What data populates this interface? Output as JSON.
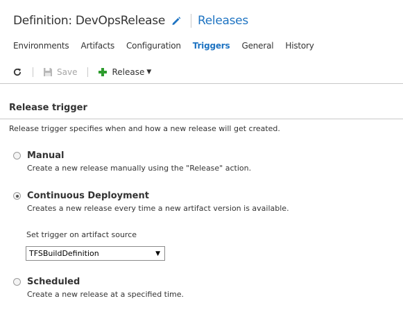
{
  "header": {
    "title": "Definition: DevOpsRelease",
    "link": "Releases"
  },
  "tabs": [
    {
      "label": "Environments"
    },
    {
      "label": "Artifacts"
    },
    {
      "label": "Configuration"
    },
    {
      "label": "Triggers",
      "active": true
    },
    {
      "label": "General"
    },
    {
      "label": "History"
    }
  ],
  "toolbar": {
    "save_label": "Save",
    "release_label": "Release",
    "icons": [
      "refresh-icon",
      "save-disk-icon",
      "plus-icon",
      "caret-down-icon"
    ],
    "colors": {
      "plus": "#2e9c2e",
      "disabled": "#a6a6a6"
    }
  },
  "trigger": {
    "section_title": "Release trigger",
    "description": "Release trigger specifies when and how a new release will get created.",
    "options": {
      "manual": {
        "title": "Manual",
        "desc": "Create a new release manually using the \"Release\" action.",
        "checked": false
      },
      "continuous": {
        "title": "Continuous Deployment",
        "desc": "Creates a new release every time a new artifact version is available.",
        "checked": true
      },
      "scheduled": {
        "title": "Scheduled",
        "desc": "Create a new release at a specified time.",
        "checked": false
      }
    },
    "artifact_label": "Set trigger on artifact source",
    "artifact_value": "TFSBuildDefinition"
  },
  "colors": {
    "accent": "#1f74c2",
    "text": "#333333",
    "divider": "#c8c8c8"
  }
}
